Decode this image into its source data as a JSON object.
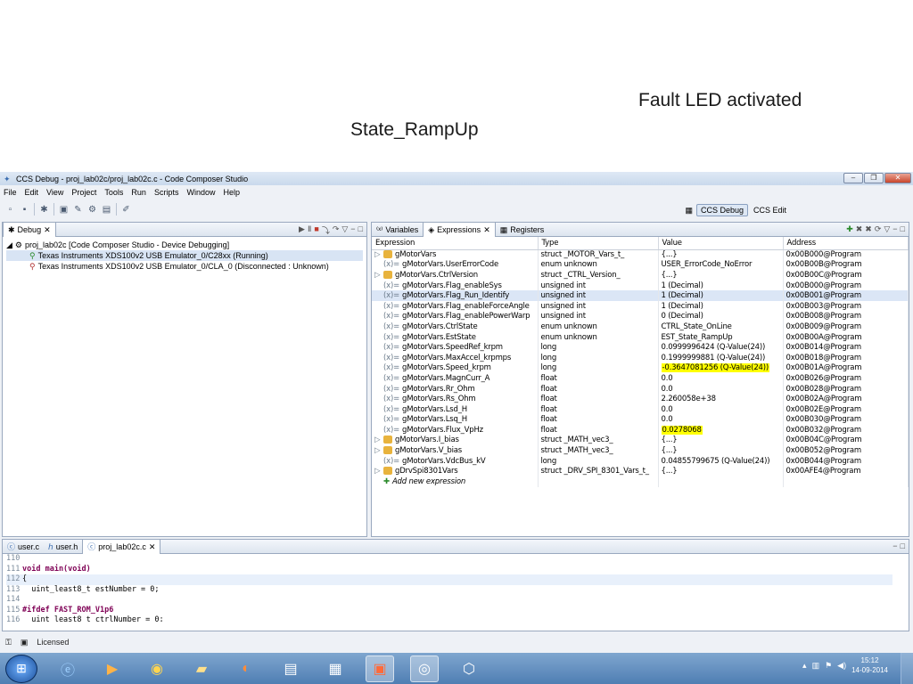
{
  "annotations": {
    "fault": "Fault LED activated",
    "state": "State_RampUp"
  },
  "window": {
    "title": "CCS Debug - proj_lab02c/proj_lab02c.c - Code Composer Studio"
  },
  "menu": [
    "File",
    "Edit",
    "View",
    "Project",
    "Tools",
    "Run",
    "Scripts",
    "Window",
    "Help"
  ],
  "perspectives": {
    "debug": "CCS Debug",
    "edit": "CCS Edit"
  },
  "debug_view": {
    "tab": "Debug",
    "project": "proj_lab02c [Code Composer Studio - Device Debugging]",
    "items": [
      "Texas Instruments XDS100v2 USB Emulator_0/C28xx (Running)",
      "Texas Instruments XDS100v2 USB Emulator_0/CLA_0 (Disconnected : Unknown)"
    ]
  },
  "expr_view": {
    "tabs": [
      "Variables",
      "Expressions",
      "Registers"
    ],
    "columns": [
      "Expression",
      "Type",
      "Value",
      "Address"
    ],
    "rows": [
      {
        "expr": "gMotorVars",
        "type": "struct _MOTOR_Vars_t_",
        "value": "{...}",
        "addr": "0x00B000@Program",
        "struct": true
      },
      {
        "expr": "gMotorVars.UserErrorCode",
        "type": "enum unknown",
        "value": "USER_ErrorCode_NoError",
        "addr": "0x00B00B@Program"
      },
      {
        "expr": "gMotorVars.CtrlVersion",
        "type": "struct _CTRL_Version_",
        "value": "{...}",
        "addr": "0x00B00C@Program",
        "struct": true
      },
      {
        "expr": "gMotorVars.Flag_enableSys",
        "type": "unsigned int",
        "value": "1 (Decimal)",
        "addr": "0x00B000@Program"
      },
      {
        "expr": "gMotorVars.Flag_Run_Identify",
        "type": "unsigned int",
        "value": "1 (Decimal)",
        "addr": "0x00B001@Program",
        "selected": true
      },
      {
        "expr": "gMotorVars.Flag_enableForceAngle",
        "type": "unsigned int",
        "value": "1 (Decimal)",
        "addr": "0x00B003@Program"
      },
      {
        "expr": "gMotorVars.Flag_enablePowerWarp",
        "type": "unsigned int",
        "value": "0 (Decimal)",
        "addr": "0x00B008@Program"
      },
      {
        "expr": "gMotorVars.CtrlState",
        "type": "enum unknown",
        "value": "CTRL_State_OnLine",
        "addr": "0x00B009@Program"
      },
      {
        "expr": "gMotorVars.EstState",
        "type": "enum unknown",
        "value": "EST_State_RampUp",
        "addr": "0x00B00A@Program"
      },
      {
        "expr": "gMotorVars.SpeedRef_krpm",
        "type": "long",
        "value": "0.0999996424 (Q-Value(24))",
        "addr": "0x00B014@Program"
      },
      {
        "expr": "gMotorVars.MaxAccel_krpmps",
        "type": "long",
        "value": "0.1999999881 (Q-Value(24))",
        "addr": "0x00B018@Program"
      },
      {
        "expr": "gMotorVars.Speed_krpm",
        "type": "long",
        "value": "-0.3647081256 (Q-Value(24))",
        "addr": "0x00B01A@Program",
        "highlight": true
      },
      {
        "expr": "gMotorVars.MagnCurr_A",
        "type": "float",
        "value": "0.0",
        "addr": "0x00B026@Program"
      },
      {
        "expr": "gMotorVars.Rr_Ohm",
        "type": "float",
        "value": "0.0",
        "addr": "0x00B028@Program"
      },
      {
        "expr": "gMotorVars.Rs_Ohm",
        "type": "float",
        "value": "2.260058e+38",
        "addr": "0x00B02A@Program"
      },
      {
        "expr": "gMotorVars.Lsd_H",
        "type": "float",
        "value": "0.0",
        "addr": "0x00B02E@Program"
      },
      {
        "expr": "gMotorVars.Lsq_H",
        "type": "float",
        "value": "0.0",
        "addr": "0x00B030@Program"
      },
      {
        "expr": "gMotorVars.Flux_VpHz",
        "type": "float",
        "value": "0.0278068",
        "addr": "0x00B032@Program",
        "highlight": true
      },
      {
        "expr": "gMotorVars.I_bias",
        "type": "struct _MATH_vec3_",
        "value": "{...}",
        "addr": "0x00B04C@Program",
        "struct": true
      },
      {
        "expr": "gMotorVars.V_bias",
        "type": "struct _MATH_vec3_",
        "value": "{...}",
        "addr": "0x00B052@Program",
        "struct": true
      },
      {
        "expr": "gMotorVars.VdcBus_kV",
        "type": "long",
        "value": "0.04855799675 (Q-Value(24))",
        "addr": "0x00B044@Program"
      },
      {
        "expr": "gDrvSpi8301Vars",
        "type": "struct _DRV_SPI_8301_Vars_t_",
        "value": "{...}",
        "addr": "0x00AFE4@Program",
        "struct": true
      }
    ],
    "add_new": "Add new expression",
    "highlight_color": "#ffff00"
  },
  "editor": {
    "tabs": [
      "user.c",
      "user.h",
      "proj_lab02c.c"
    ],
    "lines": [
      {
        "n": "110",
        "code": ""
      },
      {
        "n": "111",
        "code": "void main(void)"
      },
      {
        "n": "112",
        "code": "{"
      },
      {
        "n": "113",
        "code": "  uint_least8_t estNumber = 0;"
      },
      {
        "n": "114",
        "code": ""
      },
      {
        "n": "115",
        "code": "#ifdef FAST_ROM_V1p6"
      },
      {
        "n": "116",
        "code": "  uint_least8_t ctrlNumber = 0;"
      }
    ]
  },
  "status": {
    "license": "Licensed"
  },
  "clock": {
    "time": "15:12",
    "date": "14-09-2014"
  }
}
